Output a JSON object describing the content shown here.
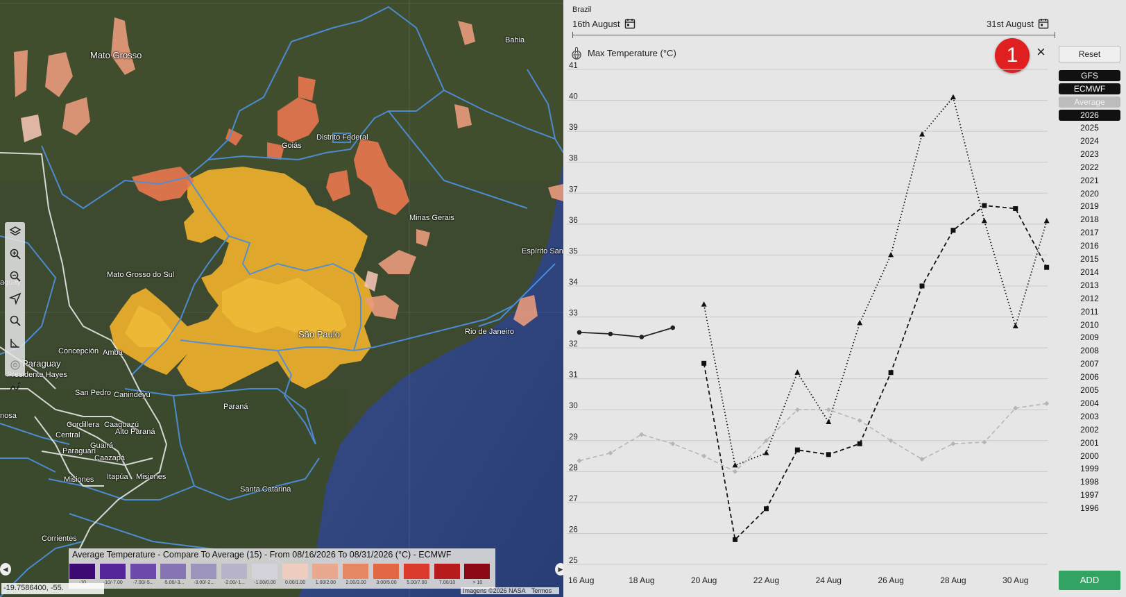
{
  "map": {
    "place_labels": [
      "Mato Grosso",
      "Bahia",
      "Distrito Federal",
      "Goiás",
      "Minas Gerais",
      "Mato Grosso do Sul",
      "Espírito San",
      "São Paulo",
      "Rio de Janeiro",
      "Paraguay",
      "Concepción",
      "Amba",
      "Presidente Hayes",
      "San Pedro",
      "Canindeyú",
      "Paraná",
      "Cordillera",
      "Caaguazú",
      "Alto Paraná",
      "Central",
      "Paraguarí",
      "Guairá",
      "Caazapá",
      "Misiones",
      "Itapúa",
      "Misiones",
      "Santa Catarina",
      "Corrientes",
      "nosa",
      "aguay"
    ],
    "coordinates": "-19.7586400, -55.",
    "attribution": [
      "Imagens ©2026 NASA",
      "Termos"
    ],
    "left_arrow": "◀",
    "right_arrow": "▶",
    "tools": [
      "layers-icon",
      "zoom-in-icon",
      "zoom-out-icon",
      "navigate-icon",
      "search-icon",
      "measure-icon",
      "target-icon",
      "draw-icon"
    ]
  },
  "legend": {
    "title": "Average Temperature - Compare To Average (15) - From 08/16/2026 To 08/31/2026 (°C) - ECMWF",
    "items": [
      {
        "label": "-10",
        "color": "#3d0a73"
      },
      {
        "label": "-10/-7.00",
        "color": "#55269a"
      },
      {
        "label": "-7.00/-5...",
        "color": "#6c4aa9"
      },
      {
        "label": "-5.00/-3...",
        "color": "#8674b4"
      },
      {
        "label": "-3.00/-2...",
        "color": "#9c94bd"
      },
      {
        "label": "-2.00/-1...",
        "color": "#b7b3cb"
      },
      {
        "label": "-1.00/0.00",
        "color": "#d4d2da"
      },
      {
        "label": "0.00/1.00",
        "color": "#efcdbf"
      },
      {
        "label": "1.00/2.00",
        "color": "#e9a98e"
      },
      {
        "label": "2.00/3.00",
        "color": "#e68763"
      },
      {
        "label": "3.00/5.00",
        "color": "#e26844"
      },
      {
        "label": "5.00/7.00",
        "color": "#d93a2c"
      },
      {
        "label": "7.00/10",
        "color": "#b81b1c"
      },
      {
        "label": "> 10",
        "color": "#8b0a14"
      }
    ]
  },
  "panel": {
    "region": "Brazil",
    "start_date": "16th August",
    "end_date": "31st August",
    "chart_title": "Max Temperature (°C)",
    "badge": "1",
    "close": "×",
    "reset": "Reset",
    "models": [
      {
        "label": "GFS",
        "style": "dark"
      },
      {
        "label": "ECMWF",
        "style": "dark"
      },
      {
        "label": "Average",
        "style": "grey"
      },
      {
        "label": "2026",
        "style": "dark"
      }
    ],
    "years": [
      "2025",
      "2024",
      "2023",
      "2022",
      "2021",
      "2020",
      "2019",
      "2018",
      "2017",
      "2016",
      "2015",
      "2014",
      "2013",
      "2012",
      "2011",
      "2010",
      "2009",
      "2008",
      "2007",
      "2006",
      "2005",
      "2004",
      "2003",
      "2002",
      "2001",
      "2000",
      "1999",
      "1998",
      "1997",
      "1996"
    ],
    "add": "ADD"
  },
  "chart_data": {
    "type": "line",
    "title": "Max Temperature (°C)",
    "x": [
      "16 Aug",
      "17 Aug",
      "18 Aug",
      "19 Aug",
      "20 Aug",
      "21 Aug",
      "22 Aug",
      "23 Aug",
      "24 Aug",
      "25 Aug",
      "26 Aug",
      "27 Aug",
      "28 Aug",
      "29 Aug",
      "30 Aug",
      "31 Aug"
    ],
    "x_tick_labels": [
      "16 Aug",
      "18 Aug",
      "20 Aug",
      "22 Aug",
      "24 Aug",
      "26 Aug",
      "28 Aug",
      "30 Aug"
    ],
    "ylim": [
      25,
      41
    ],
    "y_ticks": [
      25,
      26,
      27,
      28,
      29,
      30,
      31,
      32,
      33,
      34,
      35,
      36,
      37,
      38,
      39,
      40,
      41
    ],
    "grid": true,
    "series": [
      {
        "name": "2026",
        "style": "solid",
        "marker": "circle",
        "color": "#222222",
        "values": [
          32.5,
          32.45,
          32.35,
          32.65,
          null,
          null,
          null,
          null,
          null,
          null,
          null,
          null,
          null,
          null,
          null,
          null
        ]
      },
      {
        "name": "GFS",
        "style": "dotted",
        "marker": "triangle",
        "color": "#111111",
        "values": [
          null,
          null,
          null,
          null,
          33.4,
          28.2,
          28.6,
          31.2,
          29.6,
          32.8,
          35.0,
          38.9,
          40.1,
          36.1,
          32.7,
          36.1
        ]
      },
      {
        "name": "ECMWF",
        "style": "dashed",
        "marker": "square",
        "color": "#111111",
        "values": [
          null,
          null,
          null,
          null,
          31.5,
          25.8,
          26.8,
          28.7,
          28.55,
          28.9,
          31.2,
          34.0,
          35.8,
          36.6,
          36.5,
          34.6
        ]
      },
      {
        "name": "Average",
        "style": "dashed",
        "marker": "diamond",
        "color": "#b5b5b5",
        "values": [
          28.35,
          28.6,
          29.2,
          28.9,
          28.5,
          28.0,
          29.0,
          30.0,
          30.0,
          29.65,
          29.0,
          28.4,
          28.9,
          28.95,
          30.05,
          30.2
        ]
      }
    ]
  }
}
